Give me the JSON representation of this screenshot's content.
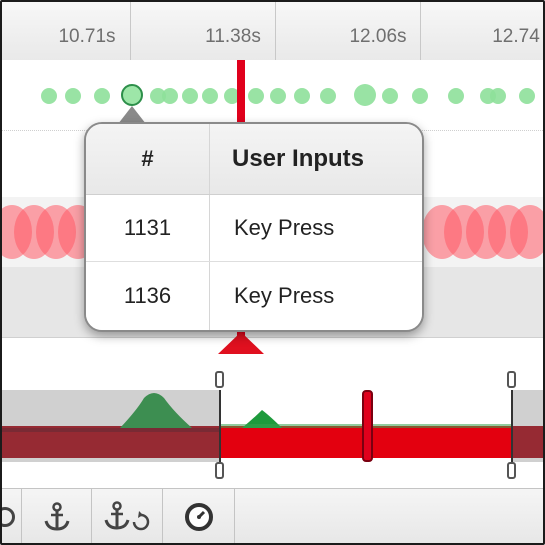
{
  "ruler": {
    "ticks": [
      {
        "label": "10.71s"
      },
      {
        "label": "11.38s"
      },
      {
        "label": "12.06s"
      },
      {
        "label": "12.74"
      }
    ]
  },
  "popover": {
    "header": {
      "number": "#",
      "title": "User Inputs"
    },
    "rows": [
      {
        "number": "1131",
        "input": "Key Press"
      },
      {
        "number": "1136",
        "input": "Key Press"
      }
    ]
  },
  "overview": {
    "playhead_fraction": 0.67
  },
  "toolbar": {
    "buttons": [
      "anchor-icon",
      "anchor-reset-icon",
      "clock-icon"
    ]
  },
  "colors": {
    "playhead": "#e0001c",
    "input_dot": "#8ee09a",
    "red_track": "#ff5a66",
    "overview_band": "#e3000f",
    "overview_peak": "#1e9a3c"
  }
}
